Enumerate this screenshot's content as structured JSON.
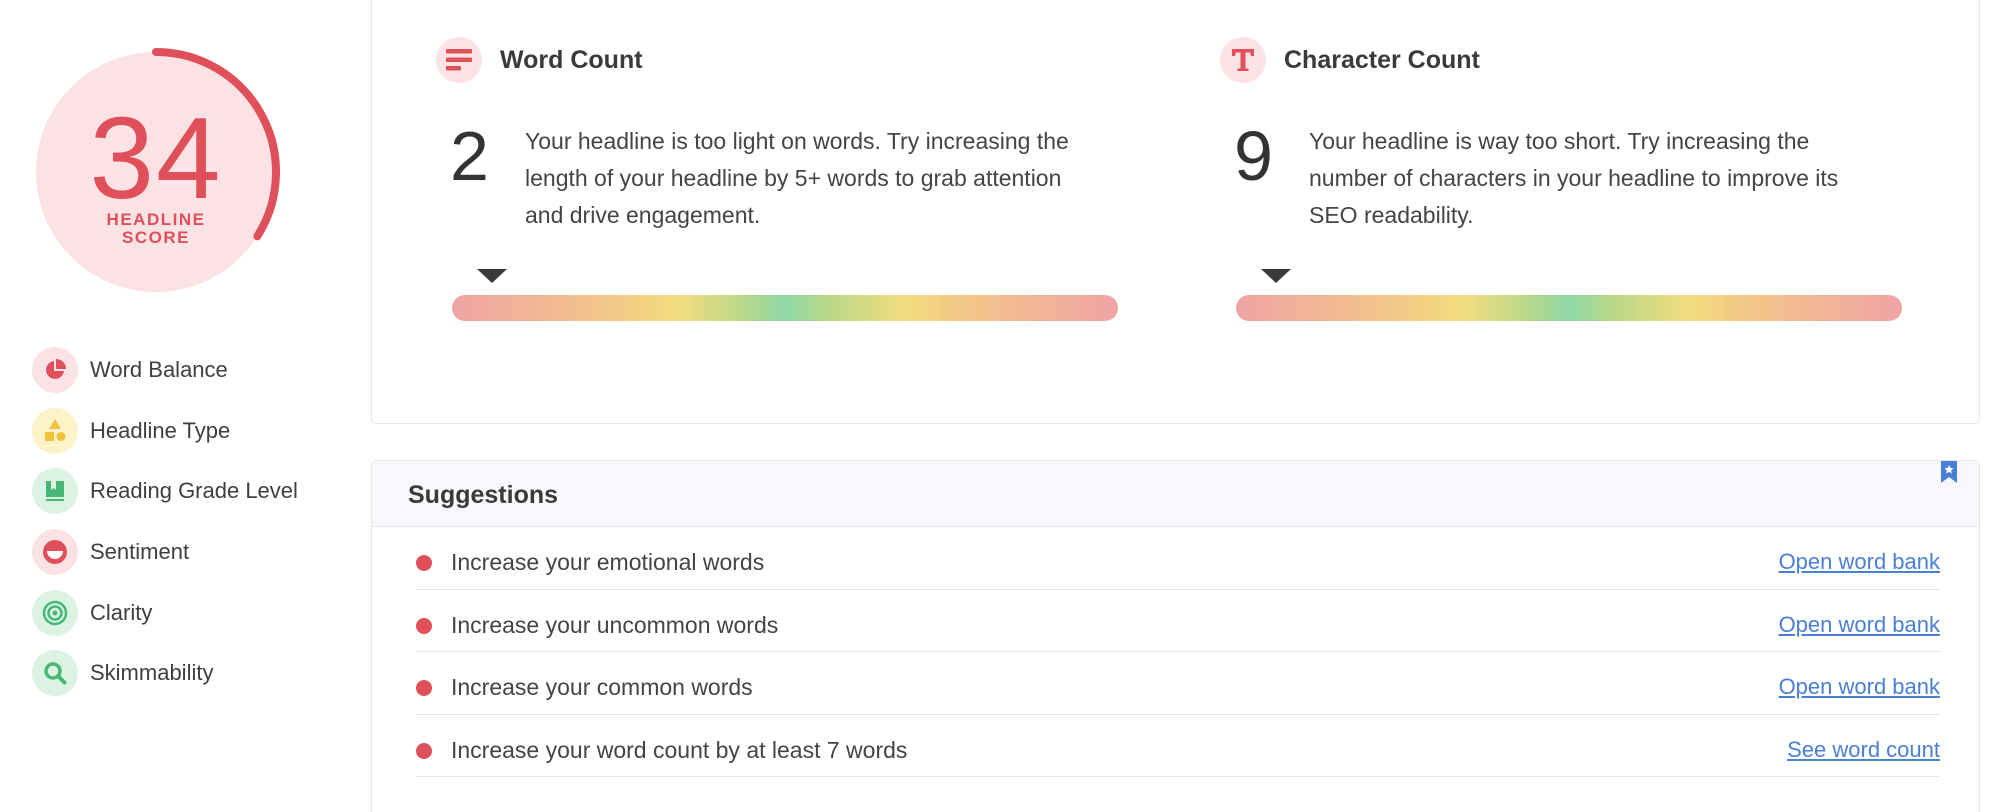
{
  "score": {
    "value": "34",
    "label_line1": "HEADLINE",
    "label_line2": "SCORE",
    "progress": 0.34,
    "color": "#e0505b",
    "track_color": "#fbe2e4"
  },
  "sidebar": {
    "items": [
      {
        "label": "Word Balance",
        "icon": "pie-chart-icon",
        "bg": "#fbe2e4",
        "fg": "#e0505b"
      },
      {
        "label": "Headline Type",
        "icon": "shapes-icon",
        "bg": "#fdf2c8",
        "fg": "#f0c33a"
      },
      {
        "label": "Reading Grade Level",
        "icon": "book-icon",
        "bg": "#dcf3e4",
        "fg": "#48b878"
      },
      {
        "label": "Sentiment",
        "icon": "sentiment-icon",
        "bg": "#fbe2e4",
        "fg": "#e0505b"
      },
      {
        "label": "Clarity",
        "icon": "target-icon",
        "bg": "#dcf3e4",
        "fg": "#48b878"
      },
      {
        "label": "Skimmability",
        "icon": "magnifier-icon",
        "bg": "#dcf3e4",
        "fg": "#48b878"
      }
    ]
  },
  "metrics": [
    {
      "title": "Word Count",
      "icon": "text-lines-icon",
      "value": "2",
      "description": "Your headline is too light on words. Try increasing the length of your headline by 5+ words to grab attention and drive engagement.",
      "marker_position": 0.06
    },
    {
      "title": "Character Count",
      "icon": "letter-t-icon",
      "value": "9",
      "description": "Your headline is way too short. Try increasing the number of characters in your headline to improve its SEO readability.",
      "marker_position": 0.06
    }
  ],
  "suggestions": {
    "title": "Suggestions",
    "items": [
      {
        "text": "Increase your emotional words",
        "link": "Open word bank"
      },
      {
        "text": "Increase your uncommon words",
        "link": "Open word bank"
      },
      {
        "text": "Increase your common words",
        "link": "Open word bank"
      },
      {
        "text": "Increase your word count by at least 7 words",
        "link": "See word count"
      }
    ]
  }
}
